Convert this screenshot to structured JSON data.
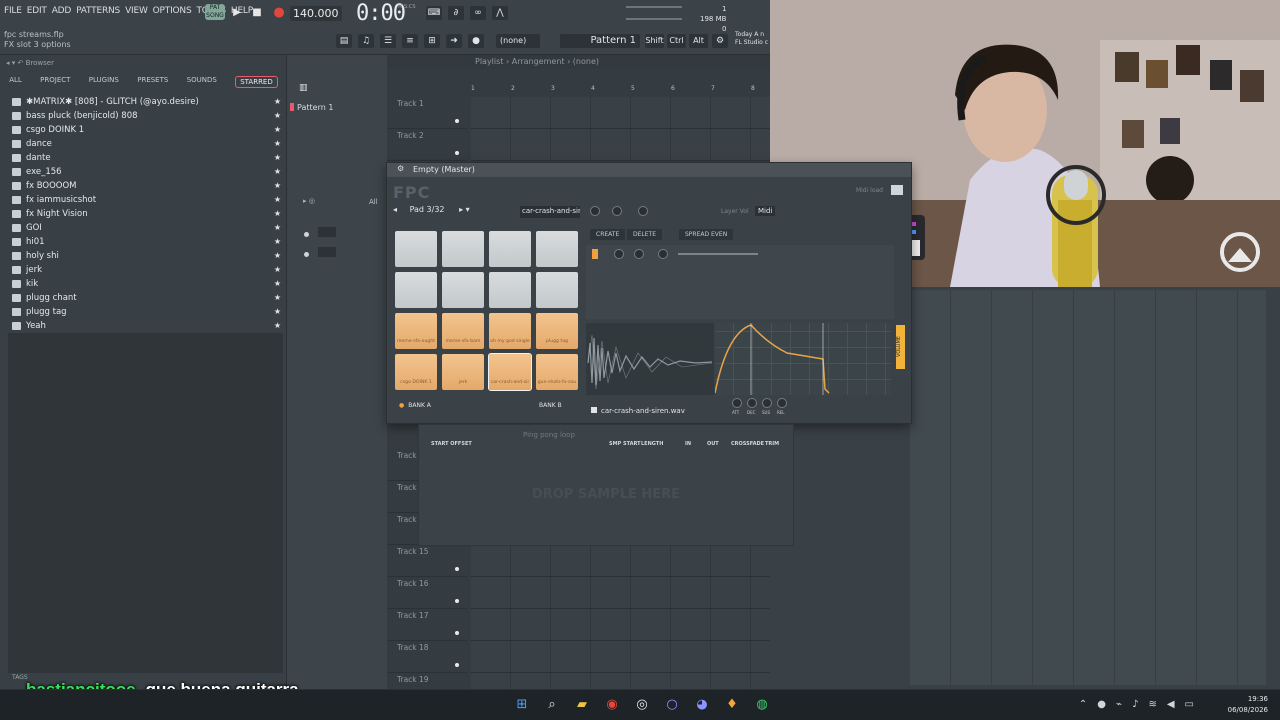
{
  "menu": [
    "FILE",
    "EDIT",
    "ADD",
    "PATTERNS",
    "VIEW",
    "OPTIONS",
    "TOOLS",
    "HELP"
  ],
  "pat_label": "PAT SONG",
  "tempo": "140.000",
  "timecode": "0:00",
  "timecode_unit": "M:S:CS",
  "cpu": {
    "line1": "1",
    "ram": "198 MB",
    "line3": "0"
  },
  "file": {
    "name": "fpc streams.flp",
    "hint": "FX slot 3 options"
  },
  "pattern_selector": {
    "none_label": "(none)",
    "pattern": "Pattern 1"
  },
  "keys": {
    "shift": "Shift",
    "ctrl": "Ctrl",
    "alt": "Alt"
  },
  "today": {
    "line1": "Today   A n",
    "line2": "FL Studio c"
  },
  "browser": {
    "header": "Browser",
    "tabs": [
      "ALL",
      "PROJECT",
      "PLUGINS",
      "PRESETS",
      "SOUNDS",
      "STARRED"
    ],
    "active_tab": "STARRED",
    "items": [
      "✱MATRIX✱ [808] - GLITCH (@ayo.desire)",
      "bass pluck (benjicold) 808",
      "csgo DOINK 1",
      "dance",
      "dante",
      "exe_156",
      "fx BOOOOM",
      "fx iammusicshot",
      "fx Night Vision",
      "GOI",
      "hi01",
      "holy shi",
      "jerk",
      "kik",
      "plugg chant",
      "plugg tag",
      "Yeah"
    ],
    "tags_label": "TAGS"
  },
  "rack": {
    "pattern": "Pattern 1",
    "filter": "All"
  },
  "playlist": {
    "header": "Playlist › Arrangement › (none)",
    "ruler": [
      "1",
      "2",
      "3",
      "4",
      "5",
      "6",
      "7",
      "8"
    ],
    "tracks_top": [
      "Track 1",
      "Track 2"
    ],
    "tracks_mid": [
      "Track",
      "Track",
      "Track"
    ],
    "tracks_bottom": [
      "Track 15",
      "Track 16",
      "Track 17",
      "Track 18",
      "Track 19"
    ]
  },
  "fpc": {
    "title": "Empty (Master)",
    "logo": "FPC",
    "midi_label": "Midi load",
    "pad_label": "Pad 3/32",
    "sample": "car-crash-and-sir",
    "layer_vol": "Layer Vol",
    "midi": "Midi",
    "buttons": {
      "create": "CREATE",
      "delete": "DELETE",
      "spread": "SPREAD EVEN"
    },
    "pads": [
      "",
      "",
      "",
      "",
      "",
      "",
      "",
      "",
      "meme-sfx-ought",
      "meme-sfx-bam",
      "oh my god single",
      "plugg tag",
      "csgo DOINK 1",
      "jerk",
      "car-crash-and-sir",
      "gun-shots-fx-sou"
    ],
    "bank_a": "BANK A",
    "bank_b": "BANK B",
    "wavfile": "car-crash-and-siren.wav",
    "volume": "VOLUME",
    "env_knobs": [
      "ATT",
      "DEC",
      "SUS",
      "REL"
    ]
  },
  "sample_panel": {
    "labels": [
      "START OFFSET",
      "SMP START",
      "LENGTH",
      "IN",
      "OUT",
      "CROSSFADE",
      "TRIM"
    ],
    "ping_pong": "Ping pong loop",
    "drop": "DROP SAMPLE HERE"
  },
  "chat": {
    "user": "bastiancitooe",
    "message": "que buena guitarra"
  },
  "clock": {
    "time": "19:36",
    "date": "06/08/2026"
  },
  "colors": {
    "accent": "#e85a70",
    "pad_warm": "#e9b077",
    "volume_tab": "#f1b33a",
    "chat_user": "#3be25c"
  }
}
